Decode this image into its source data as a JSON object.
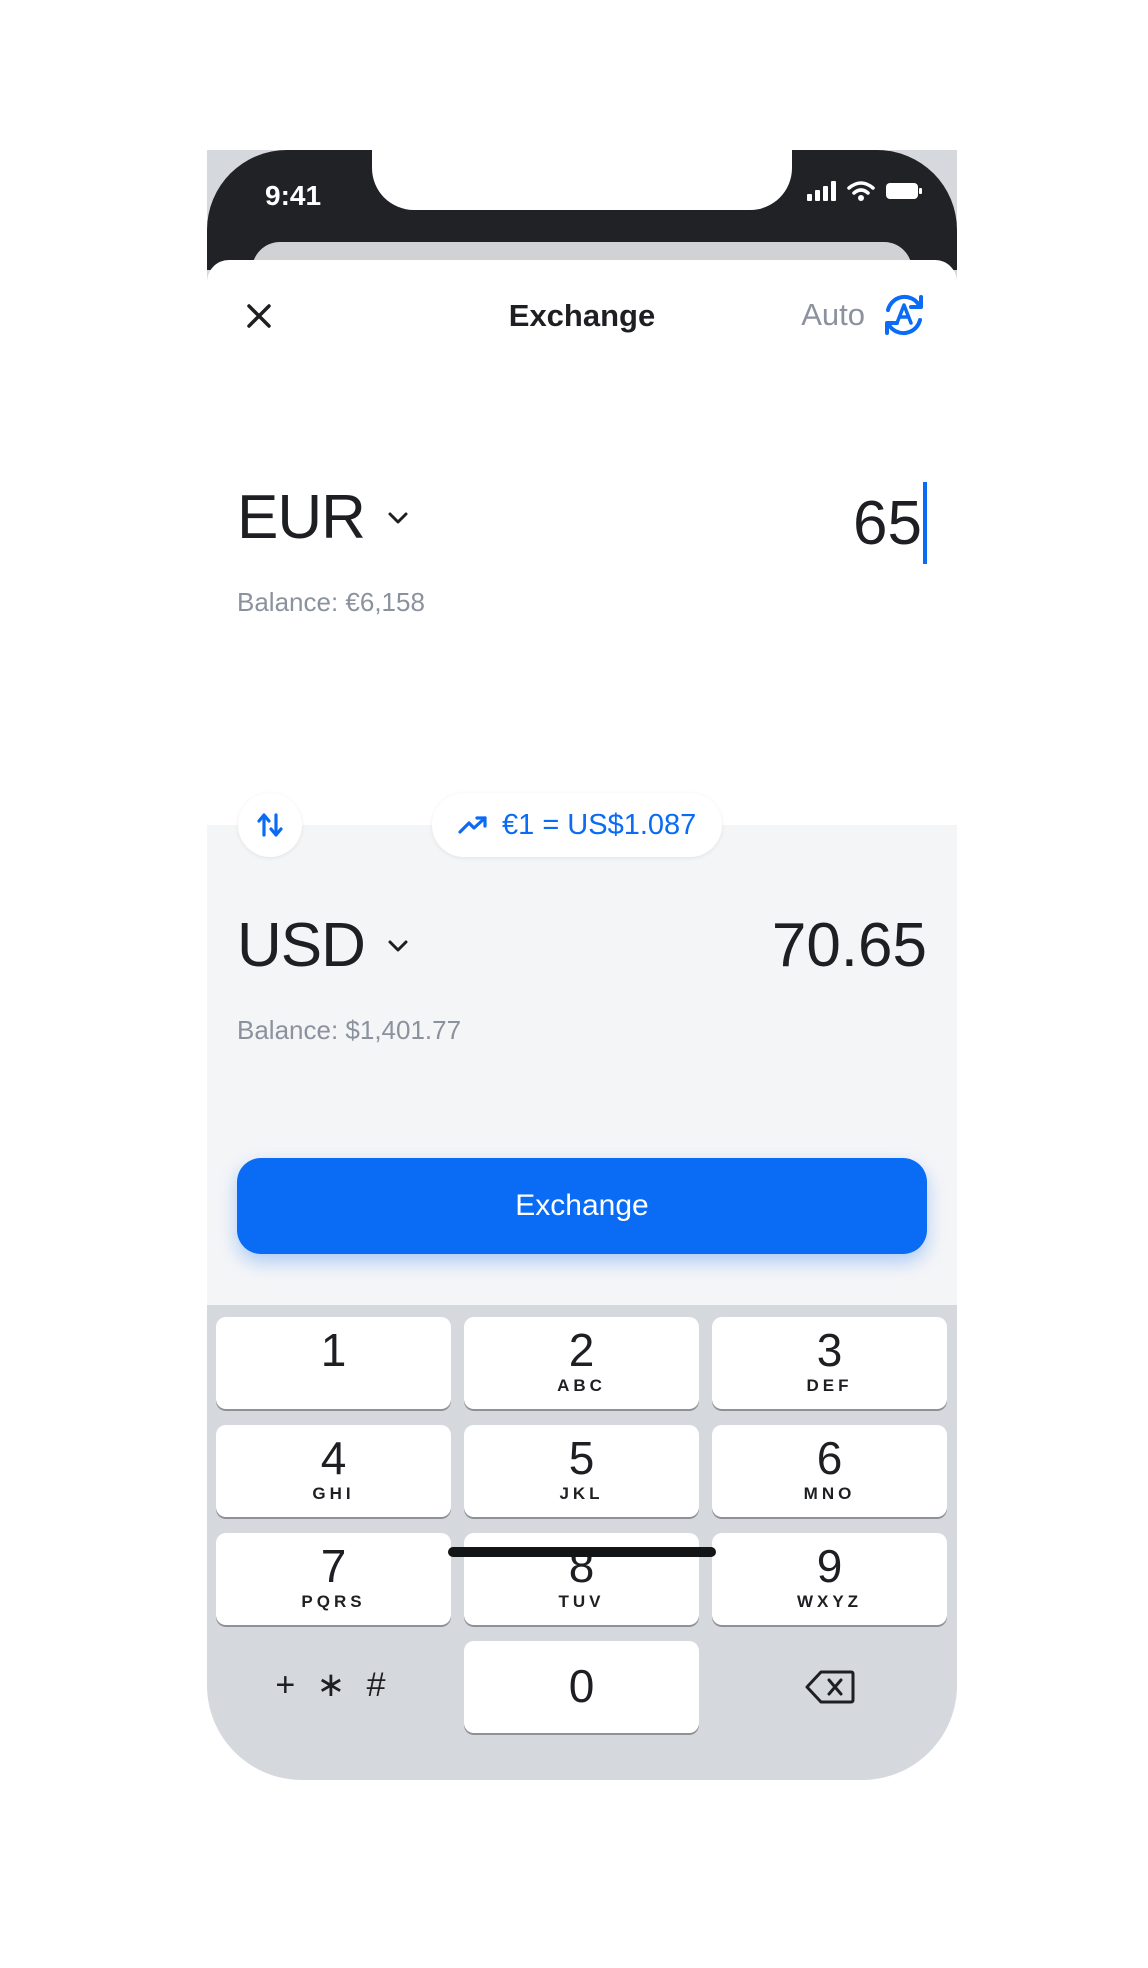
{
  "status_bar": {
    "time": "9:41"
  },
  "nav": {
    "title": "Exchange",
    "auto_label": "Auto"
  },
  "from": {
    "currency": "EUR",
    "amount": "65",
    "balance": "Balance: €6,158"
  },
  "rate": {
    "text": "€1 = US$1.087"
  },
  "to": {
    "currency": "USD",
    "amount": "70.65",
    "balance": "Balance: $1,401.77"
  },
  "exchange_button": {
    "label": "Exchange"
  },
  "keypad": {
    "keys": [
      {
        "digit": "1",
        "letters": ""
      },
      {
        "digit": "2",
        "letters": "ABC"
      },
      {
        "digit": "3",
        "letters": "DEF"
      },
      {
        "digit": "4",
        "letters": "GHI"
      },
      {
        "digit": "5",
        "letters": "JKL"
      },
      {
        "digit": "6",
        "letters": "MNO"
      },
      {
        "digit": "7",
        "letters": "PQRS"
      },
      {
        "digit": "8",
        "letters": "TUV"
      },
      {
        "digit": "9",
        "letters": "WXYZ"
      },
      {
        "digit": "0",
        "letters": ""
      }
    ],
    "symbols": "+ ∗ #"
  },
  "colors": {
    "accent": "#0a6cf5",
    "muted_text": "#8b929e",
    "status_bar": "#202225",
    "keyboard_bg": "#d5d8dd"
  }
}
